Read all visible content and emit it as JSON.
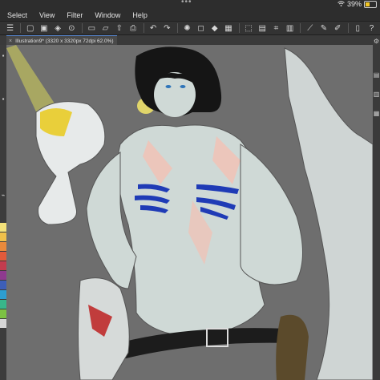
{
  "status": {
    "time": "",
    "battery": "39%",
    "battery_level": 0.39
  },
  "menu": [
    "Select",
    "View",
    "Filter",
    "Window",
    "Help"
  ],
  "toolbar": {
    "icons": [
      "menu-icon",
      "new-file-icon",
      "canvas-icon",
      "save-icon",
      "open-icon",
      "export-icon",
      "print-icon",
      "undo-icon",
      "redo-icon",
      "settings-icon",
      "transform-icon",
      "fill-icon",
      "grid-icon",
      "select-all-icon",
      "deselect-icon",
      "crop-icon",
      "ruler-icon",
      "pen-icon",
      "brush-icon",
      "layer-icon",
      "help-icon"
    ]
  },
  "tab": {
    "close": "×",
    "title": "Illustration9* (3320 x 3320px 72dpi 62.0%)"
  },
  "colors": {
    "accent": "#5a8ad6",
    "bg": "#2b2b2b",
    "canvas": "#6e6e6e"
  },
  "palette": [
    "#f3e17a",
    "#f0c04a",
    "#e98a3b",
    "#e25a3a",
    "#c33c4e",
    "#8e3a8f",
    "#3d5fb8",
    "#2d9ed1",
    "#38b68a",
    "#7cc243",
    "#d6d6d6"
  ]
}
